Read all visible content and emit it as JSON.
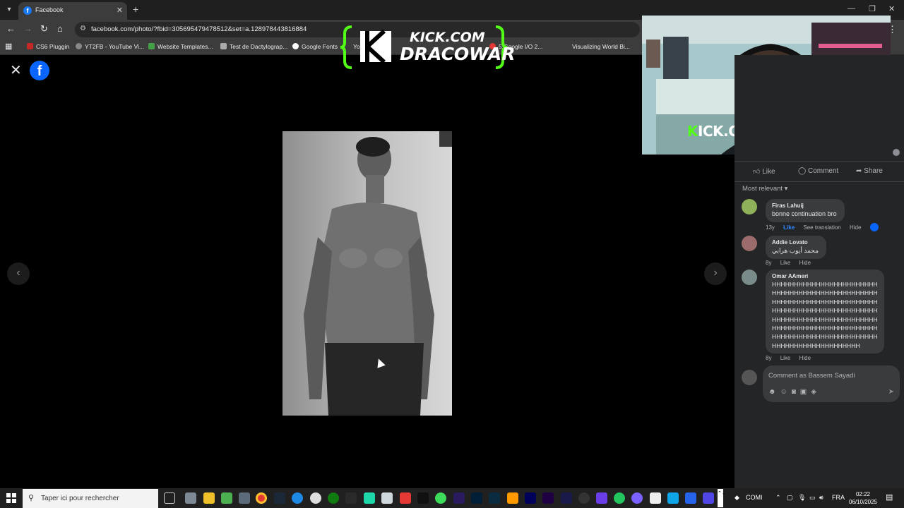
{
  "browser": {
    "tab_title": "Facebook",
    "url": "facebook.com/photo/?fbid=305695479478512&set=a.128978443816884",
    "bookmarks": [
      "CS6 Pluggin",
      "YT2FB - YouTube Vi...",
      "Website Templates...",
      "Test de Dactylograp...",
      "Google Fonts",
      "Yo",
      "5 Google I/O 2...",
      "Visualizing World Bi..."
    ]
  },
  "overlay": {
    "logo_line1": "KICK.COM",
    "logo_line2": "DRACOWAR",
    "webcam_k": "K",
    "webcam_rest": "ICK.COM/DRACOWAR"
  },
  "panel": {
    "actions": {
      "like": "Like",
      "comment": "Comment",
      "share": "Share"
    },
    "sort_label": "Most relevant",
    "comments": [
      {
        "name": "Firas Lahuij",
        "text": "bonne continuation bro",
        "age": "13y",
        "like": "Like",
        "translate": "See translation",
        "hide": "Hide"
      },
      {
        "name": "Addie Lovato",
        "text": "محمد أيوب هرابي",
        "age": "8y",
        "like": "Like",
        "hide": "Hide"
      },
      {
        "name": "Omar AAmeri",
        "text": "HHHHHHHHHHHHHHHHHHHHHHHHHHHHHHHHHHHHHHHHHHHHHHHHHHHHHHHHHHHHHHHHHHHHHHHHHHHHHHHHHHHHHHHHHHHHHHHHHHHHHHHHHHHHHHHHHHHHHHHHHHHHHHHHHHHHHHHHHHHHHHHHHHHHHHHHHHHHHHHHHHHHHHHHHHHHHHHHHHHHHHHHHHHH",
        "age": "8y",
        "like": "Like",
        "hide": "Hide"
      }
    ],
    "composer_placeholder": "Comment as Bassem Sayadi"
  },
  "taskbar": {
    "search_placeholder": "Taper ici pour rechercher",
    "tray_label": "COMI",
    "language": "FRA",
    "time": "02:22",
    "date": "06/10/2025"
  },
  "colors": {
    "facebook_blue": "#0866ff",
    "kick_green": "#53fc18"
  }
}
